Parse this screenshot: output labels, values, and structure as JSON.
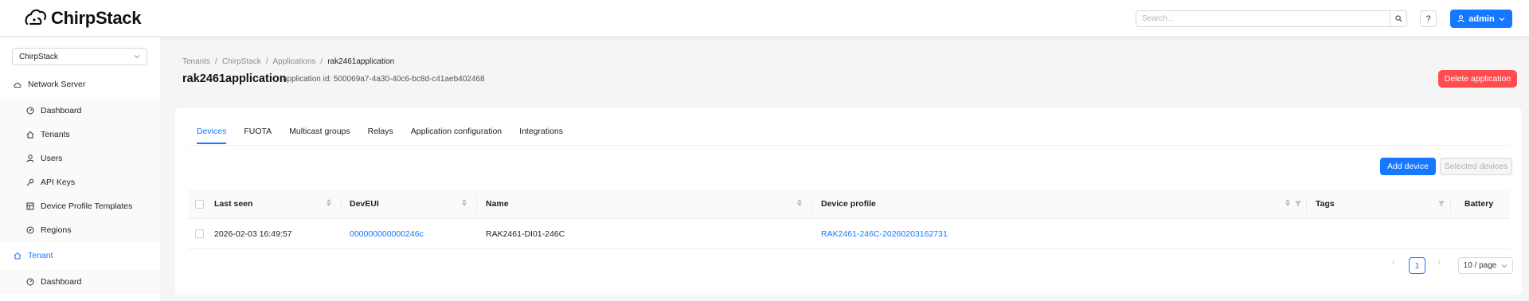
{
  "header": {
    "logo_text": "ChirpStack",
    "search_placeholder": "Search...",
    "help_label": "?",
    "user_label": "admin"
  },
  "sidebar": {
    "tenant_select": "ChirpStack",
    "network_server": {
      "label": "Network Server",
      "items": [
        "Dashboard",
        "Tenants",
        "Users",
        "API Keys",
        "Device Profile Templates",
        "Regions"
      ]
    },
    "tenant": {
      "label": "Tenant",
      "items": [
        "Dashboard"
      ]
    }
  },
  "breadcrumb": [
    "Tenants",
    "ChirpStack",
    "Applications",
    "rak2461application"
  ],
  "page": {
    "title": "rak2461application",
    "app_id": "application id: 500069a7-4a30-40c6-bc8d-c41aeb402468",
    "delete_label": "Delete application"
  },
  "tabs": [
    "Devices",
    "FUOTA",
    "Multicast groups",
    "Relays",
    "Application configuration",
    "Integrations"
  ],
  "actions": {
    "add_device": "Add device",
    "selected_devices": "Selected devices"
  },
  "table": {
    "columns": [
      "Last seen",
      "DevEUI",
      "Name",
      "Device profile",
      "Tags",
      "Battery"
    ],
    "rows": [
      {
        "last_seen": "2026-02-03 16:49:57",
        "dev_eui": "000000000000246c",
        "name": "RAK2461-DI01-246C",
        "device_profile": "RAK2461-246C-20260203162731"
      }
    ]
  },
  "pagination": {
    "current": "1",
    "page_size": "10 / page"
  },
  "colors": {
    "primary": "#1677ff",
    "danger": "#ff4d4f"
  }
}
